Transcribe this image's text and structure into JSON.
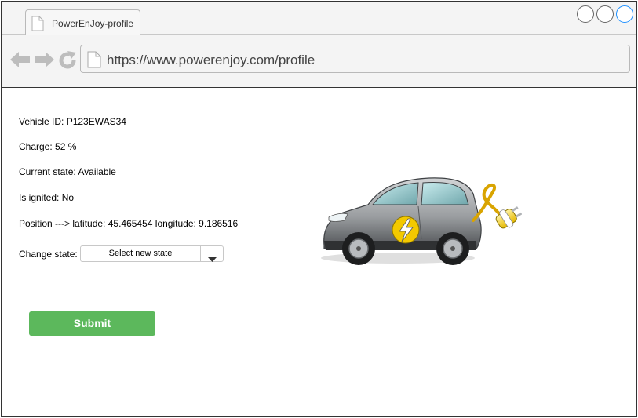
{
  "browser": {
    "tab_title": "PowerEnJoy-profile",
    "url": "https://www.powerenjoy.com/profile",
    "icons": {
      "back": "back-arrow-icon",
      "forward": "forward-arrow-icon",
      "reload": "reload-icon",
      "document": "document-icon"
    },
    "window_controls": [
      "circle",
      "circle",
      "circle-active"
    ]
  },
  "vehicle": {
    "id_label": "Vehicle ID: P123EWAS34",
    "charge_label": "Charge: 52 %",
    "state_label": "Current state: Available",
    "ignited_label": "Is ignited: No",
    "position_label": "Position --->  latitude: 45.465454  longitude: 9.186516",
    "change_state_label": "Change state:",
    "select_placeholder": "Select new state",
    "image": "electric-car-with-plug"
  },
  "actions": {
    "submit_label": "Submit"
  },
  "colors": {
    "submit": "#5cb85c",
    "active_window_control": "#1e90ff"
  }
}
